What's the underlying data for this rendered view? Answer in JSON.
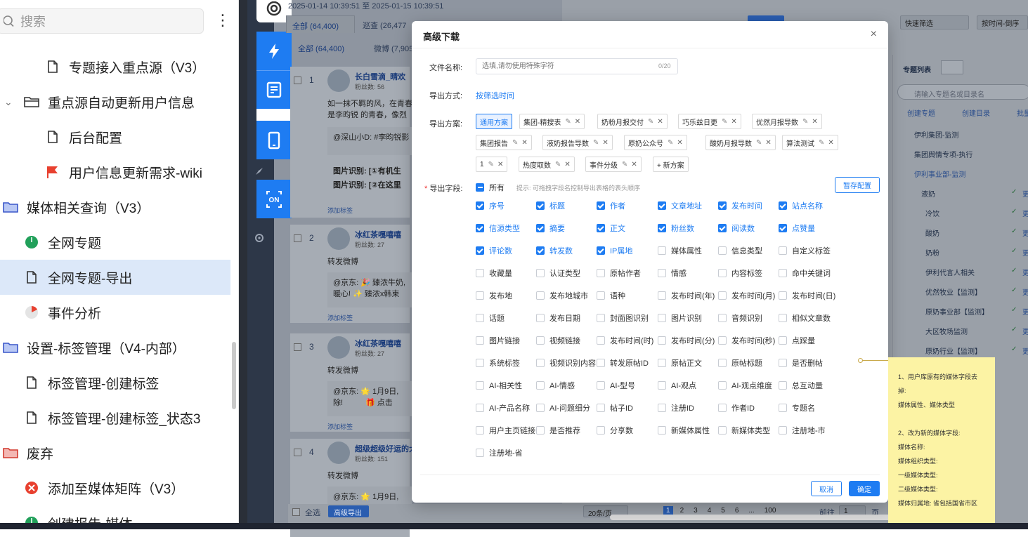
{
  "sidebar": {
    "search_placeholder": "搜索",
    "items": [
      {
        "label": "专题接入重点源（V3）",
        "icon": "document-icon"
      },
      {
        "label": "重点源自动更新用户信息",
        "icon": "folder-icon"
      },
      {
        "label": "后台配置",
        "icon": "document-icon"
      },
      {
        "label": "用户信息更新需求-wiki",
        "icon": "red-flag-icon"
      },
      {
        "label": "媒体相关查询（V3）",
        "icon": "folder-icon"
      },
      {
        "label": "全网专题",
        "icon": "green-circle-icon"
      },
      {
        "label": "全网专题-导出",
        "icon": "document-icon"
      },
      {
        "label": "事件分析",
        "icon": "pie-icon"
      },
      {
        "label": "设置-标签管理（V4-内部）",
        "icon": "folder-icon"
      },
      {
        "label": "标签管理-创建标签",
        "icon": "document-icon"
      },
      {
        "label": "标签管理-创建标签_状态3",
        "icon": "document-icon"
      },
      {
        "label": "废弃",
        "icon": "folder-icon"
      },
      {
        "label": "添加至媒体矩阵（V3）",
        "icon": "red-x-icon"
      },
      {
        "label": "创建报告-媒体",
        "icon": "green-circle-icon"
      }
    ]
  },
  "background": {
    "date_range_start": "2025-01-14 10:39:51",
    "date_range_sep": "至",
    "date_range_end": "2025-01-15 10:39:51",
    "tab_all": "全部 (64,400)",
    "tab_patrol": "巡查 (26,477",
    "subtab_all": "全部 (64,400)",
    "subtab_weibo": "微博 (7,905",
    "quick_filter": "快速筛选",
    "sort": "按时间-倒序",
    "rows": [
      {
        "num": "1",
        "name": "长白雪滴_晴欢",
        "fans": "粉丝数: 56",
        "text1": "如一抹不羁的风，在青春",
        "text2": "是李昀锐 的青春，像烈",
        "quote": "@深山小D: #李昀锐影",
        "ocr1": "图片识别: [①有机生",
        "ocr2": "图片识别: [②在这里",
        "add": "添加标签"
      },
      {
        "num": "2",
        "name": "冰红茶嘎嘻嘻",
        "fans": "粉丝数: 27",
        "text1": "转发微博",
        "quote": "@京东: 🎉 臻浓牛奶,",
        "quote2": "暖心! ✨ 臻浓x韩束",
        "add": "添加标签"
      },
      {
        "num": "3",
        "name": "冰红茶嘎嘻嘻",
        "fans": "粉丝数: 27",
        "text1": "转发微博",
        "quote": "@京东: 🌟 1月9日,",
        "quote2": "除!",
        "quote3": "🎁 点击",
        "add": "添加标签"
      },
      {
        "num": "4",
        "name": "超级超级好运的大",
        "fans": "粉丝数: 151",
        "text1": "转发微博",
        "quote": "@京东: 🌟 1月9日,"
      }
    ],
    "select_all": "全选",
    "batch_export": "高级导出",
    "page_size": "20条/页",
    "pages": [
      "1",
      "2",
      "3",
      "4",
      "5",
      "6",
      "...",
      "100"
    ],
    "goto_label": "前往",
    "goto_value": "1",
    "page_suffix": "页",
    "right_panel": {
      "title": "专题列表",
      "search_placeholder": "请输入专题名或目录名",
      "actions": [
        "创建专题",
        "创建目录",
        "批量导"
      ],
      "items": [
        "伊利集团-监测",
        "集团舆情专项-执行",
        "伊利事业部-监测",
        "液奶",
        "冷饮",
        "酸奶",
        "奶粉",
        "伊利代言人相关",
        "优然牧业【监测】",
        "原奶事业部【监测】",
        "大区牧场监测",
        "原奶行业【监测】"
      ],
      "side_labels": [
        "更",
        "更",
        "更",
        "更",
        "更",
        "更",
        "更",
        "更",
        "更"
      ]
    }
  },
  "modal": {
    "title": "高级下载",
    "close": "×",
    "file_name_label": "文件名称:",
    "file_name_placeholder": "选填,请勿使用特殊字符",
    "file_name_count": "0/20",
    "export_mode_label": "导出方式:",
    "export_mode_value": "按筛选时间",
    "export_plan_label": "导出方案:",
    "plans": [
      {
        "label": "通用方案",
        "active": true
      },
      {
        "label": "集团-精搜表"
      },
      {
        "label": "奶粉月报交付"
      },
      {
        "label": "巧乐兹日更"
      },
      {
        "label": "优然月报导数"
      },
      {
        "label": "集团报告"
      },
      {
        "label": "液奶报告导数"
      },
      {
        "label": "原奶公众号"
      },
      {
        "label": "酸奶月报导数"
      },
      {
        "label": "算法测试"
      },
      {
        "label": "1"
      },
      {
        "label": "热度取数"
      },
      {
        "label": "事件分级"
      }
    ],
    "new_plan": "+ 新方案",
    "fields_label": "导出字段:",
    "required_mark": "*",
    "all_label": "所有",
    "hint": "提示: 可拖拽字段名控制导出表格的表头顺序",
    "save_config": "暂存配置",
    "fields": [
      {
        "label": "序号",
        "checked": true
      },
      {
        "label": "标题",
        "checked": true
      },
      {
        "label": "作者",
        "checked": true
      },
      {
        "label": "文章地址",
        "checked": true
      },
      {
        "label": "发布时间",
        "checked": true
      },
      {
        "label": "站点名称",
        "checked": true
      },
      {
        "label": "信源类型",
        "checked": true
      },
      {
        "label": "摘要",
        "checked": true
      },
      {
        "label": "正文",
        "checked": true
      },
      {
        "label": "粉丝数",
        "checked": true
      },
      {
        "label": "阅读数",
        "checked": true
      },
      {
        "label": "点赞量",
        "checked": true
      },
      {
        "label": "评论数",
        "checked": true
      },
      {
        "label": "转发数",
        "checked": true
      },
      {
        "label": "IP属地",
        "checked": true
      },
      {
        "label": "媒体属性",
        "checked": false
      },
      {
        "label": "信息类型",
        "checked": false
      },
      {
        "label": "自定义标签",
        "checked": false
      },
      {
        "label": "收藏量",
        "checked": false
      },
      {
        "label": "认证类型",
        "checked": false
      },
      {
        "label": "原帖作者",
        "checked": false
      },
      {
        "label": "情感",
        "checked": false
      },
      {
        "label": "内容标签",
        "checked": false
      },
      {
        "label": "命中关键词",
        "checked": false
      },
      {
        "label": "发布地",
        "checked": false
      },
      {
        "label": "发布地城市",
        "checked": false
      },
      {
        "label": "语种",
        "checked": false
      },
      {
        "label": "发布时间(年)",
        "checked": false
      },
      {
        "label": "发布时间(月)",
        "checked": false
      },
      {
        "label": "发布时间(日)",
        "checked": false
      },
      {
        "label": "话题",
        "checked": false
      },
      {
        "label": "发布日期",
        "checked": false
      },
      {
        "label": "封面图识别",
        "checked": false
      },
      {
        "label": "图片识别",
        "checked": false
      },
      {
        "label": "音频识别",
        "checked": false
      },
      {
        "label": "相似文章数",
        "checked": false
      },
      {
        "label": "图片链接",
        "checked": false
      },
      {
        "label": "视频链接",
        "checked": false
      },
      {
        "label": "发布时间(时)",
        "checked": false
      },
      {
        "label": "发布时间(分)",
        "checked": false
      },
      {
        "label": "发布时间(秒)",
        "checked": false
      },
      {
        "label": "点踩量",
        "checked": false
      },
      {
        "label": "系统标签",
        "checked": false
      },
      {
        "label": "视频识别内容",
        "checked": false
      },
      {
        "label": "转发原帖ID",
        "checked": false
      },
      {
        "label": "原帖正文",
        "checked": false
      },
      {
        "label": "原帖标题",
        "checked": false
      },
      {
        "label": "是否删帖",
        "checked": false
      },
      {
        "label": "AI-相关性",
        "checked": false
      },
      {
        "label": "AI-情感",
        "checked": false
      },
      {
        "label": "AI-型号",
        "checked": false
      },
      {
        "label": "AI-观点",
        "checked": false
      },
      {
        "label": "AI-观点维度",
        "checked": false
      },
      {
        "label": "总互动量",
        "checked": false
      },
      {
        "label": "AI-产品名称",
        "checked": false
      },
      {
        "label": "AI-问题细分",
        "checked": false
      },
      {
        "label": "帖子ID",
        "checked": false
      },
      {
        "label": "注册ID",
        "checked": false
      },
      {
        "label": "作者ID",
        "checked": false
      },
      {
        "label": "专题名",
        "checked": false
      },
      {
        "label": "用户主页链接",
        "checked": false
      },
      {
        "label": "是否推荐",
        "checked": false
      },
      {
        "label": "分享数",
        "checked": false
      },
      {
        "label": "新媒体属性",
        "checked": false
      },
      {
        "label": "新媒体类型",
        "checked": false
      },
      {
        "label": "注册地-市",
        "checked": false
      },
      {
        "label": "注册地-省",
        "checked": false
      }
    ],
    "cancel": "取消",
    "confirm": "确定"
  },
  "sticky_note": {
    "lines": [
      "1、用户库原有的媒体字段去",
      "掉:",
      "媒体属性、媒体类型",
      "",
      "2、改为新的媒体字段:",
      "媒体名称:",
      "媒体组织类型:",
      "一级媒体类型:",
      "二级媒体类型:",
      "媒体归属地: 省包括国省市区"
    ]
  },
  "colors": {
    "accent": "#1e7cf2",
    "selected_row": "#dce8f9",
    "sticky": "#fcf3a4",
    "overlay": "#8e95a0"
  }
}
